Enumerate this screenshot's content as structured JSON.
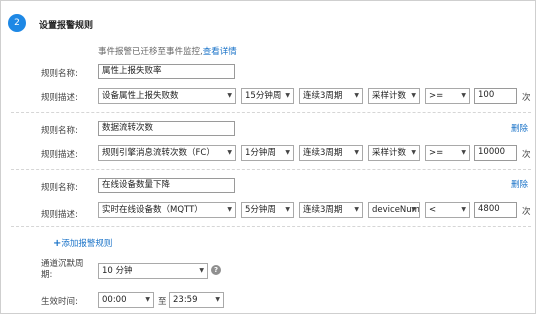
{
  "step": {
    "number": "2",
    "title": "设置报警规则"
  },
  "notice": {
    "text": "事件报警已迁移至事件监控,",
    "link": "查看详情"
  },
  "labels": {
    "rule_name": "规则名称:",
    "rule_desc": "规则描述:"
  },
  "rules": [
    {
      "name": "属性上报失败率",
      "metric": "设备属性上报失败数",
      "period": "15分钟周",
      "consecutive": "连续3周期",
      "stat": "采样计数",
      "operator": ">=",
      "threshold": "100",
      "unit": "次",
      "delete_label": ""
    },
    {
      "name": "数据流转次数",
      "metric": "规则引擎消息流转次数（FC）",
      "period": "1分钟周",
      "consecutive": "连续3周期",
      "stat": "采样计数",
      "operator": ">=",
      "threshold": "10000",
      "unit": "次",
      "delete_label": "删除"
    },
    {
      "name": "在线设备数量下降",
      "metric": "实时在线设备数（MQTT）",
      "period": "5分钟周",
      "consecutive": "连续3周期",
      "stat": "deviceNum",
      "operator": "<",
      "threshold": "4800",
      "unit": "次",
      "delete_label": "删除"
    }
  ],
  "add_rule": {
    "plus": "+",
    "label": "添加报警规则"
  },
  "silence": {
    "label_line1": "通道沉默周",
    "label_line2": "期:",
    "value": "10 分钟",
    "help": "?"
  },
  "effective": {
    "label": "生效时间:",
    "start": "00:00",
    "to": "至",
    "end": "23:59"
  },
  "icons": {
    "dropdown": "chevron-down-icon",
    "help": "question-icon"
  }
}
